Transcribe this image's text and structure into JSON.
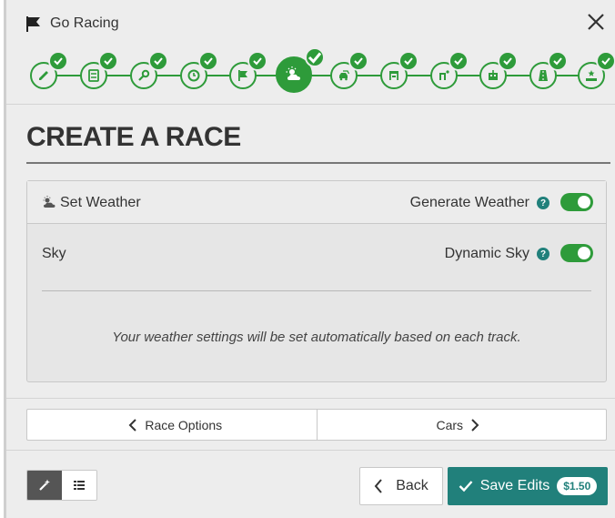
{
  "window": {
    "title": "Go Racing",
    "close_icon": "close-icon"
  },
  "steps": [
    {
      "icon": "pencil-icon",
      "completed": true
    },
    {
      "icon": "list-icon",
      "completed": true
    },
    {
      "icon": "key-icon",
      "completed": true
    },
    {
      "icon": "clock-icon",
      "completed": true
    },
    {
      "icon": "flag-icon",
      "completed": true
    },
    {
      "icon": "weather-icon",
      "completed": true,
      "active": true
    },
    {
      "icon": "cars-icon",
      "completed": true
    },
    {
      "icon": "grid-icon",
      "completed": true
    },
    {
      "icon": "pit-crew-icon",
      "completed": true
    },
    {
      "icon": "controller-icon",
      "completed": true
    },
    {
      "icon": "track-icon",
      "completed": true
    },
    {
      "icon": "podium-icon",
      "completed": true
    }
  ],
  "page": {
    "title": "CREATE A RACE"
  },
  "weather": {
    "section_label": "Set Weather",
    "generate_label": "Generate Weather",
    "generate_on": true,
    "sky_label": "Sky",
    "dynamic_label": "Dynamic Sky",
    "dynamic_on": true,
    "info": "Your weather settings will be set automatically based on each track.",
    "help_glyph": "?"
  },
  "nav": {
    "prev_label": "Race Options",
    "next_label": "Cars"
  },
  "footer": {
    "back_label": "Back",
    "save_label": "Save Edits",
    "price": "$1.50"
  },
  "colors": {
    "accent": "#2e9b3a",
    "teal": "#21807b"
  }
}
